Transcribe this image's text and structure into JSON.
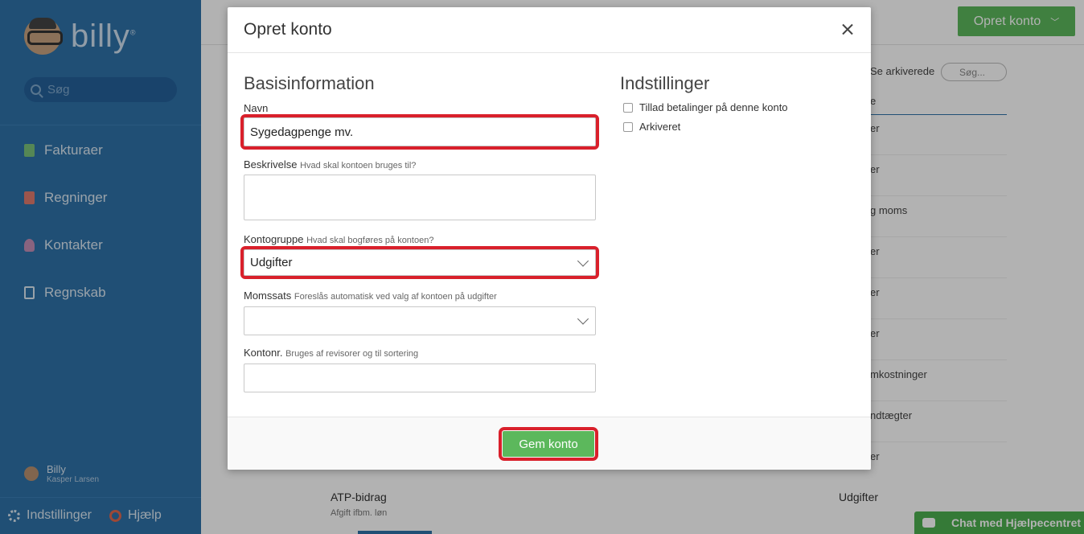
{
  "sidebar": {
    "logo_text": "billy",
    "logo_mark": "®",
    "search_placeholder": "Søg",
    "nav": [
      {
        "label": "Fakturaer",
        "icon": "invoice-icon",
        "color": "#7ac27a"
      },
      {
        "label": "Regninger",
        "icon": "bill-icon",
        "color": "#e07a6e"
      },
      {
        "label": "Kontakter",
        "icon": "contact-icon",
        "color": "#c48fb6"
      },
      {
        "label": "Regnskab",
        "icon": "accounting-icon",
        "color": "#dbe8f3"
      }
    ],
    "user": {
      "name": "Billy",
      "sub": "Kasper Larsen"
    },
    "settings_label": "Indstillinger",
    "help_label": "Hjælp"
  },
  "background": {
    "create_button": "Opret konto",
    "archived_link": "Se arkiverede",
    "search_placeholder": "Søg...",
    "column_header_fragment": "e",
    "row_fragments": [
      "er",
      "er",
      "g moms",
      "er",
      "er",
      "er",
      "mkostninger",
      "ndtægter",
      "er"
    ],
    "last_row": {
      "name": "ATP-bidrag",
      "sub": "Afgift ifbm. løn",
      "type": "Udgifter"
    },
    "chat_label": "Chat med Hjælpecentret"
  },
  "modal": {
    "title": "Opret konto",
    "basis_title": "Basisinformation",
    "settings_title": "Indstillinger",
    "fields": {
      "name": {
        "label": "Navn",
        "value": "Sygedagpenge mv."
      },
      "description": {
        "label": "Beskrivelse",
        "hint": "Hvad skal kontoen bruges til?",
        "value": ""
      },
      "group": {
        "label": "Kontogruppe",
        "hint": "Hvad skal bogføres på kontoen?",
        "value": "Udgifter"
      },
      "vat": {
        "label": "Momssats",
        "hint": "Foreslås automatisk ved valg af kontoen på udgifter",
        "value": ""
      },
      "number": {
        "label": "Kontonr.",
        "hint": "Bruges af revisorer og til sortering",
        "value": ""
      }
    },
    "checkboxes": [
      {
        "label": "Tillad betalinger på denne konto",
        "checked": false
      },
      {
        "label": "Arkiveret",
        "checked": false
      }
    ],
    "save_button": "Gem konto"
  },
  "colors": {
    "sidebar": "#2e71a8",
    "primary_green": "#5cb85c",
    "highlight_red": "#d9202b"
  }
}
